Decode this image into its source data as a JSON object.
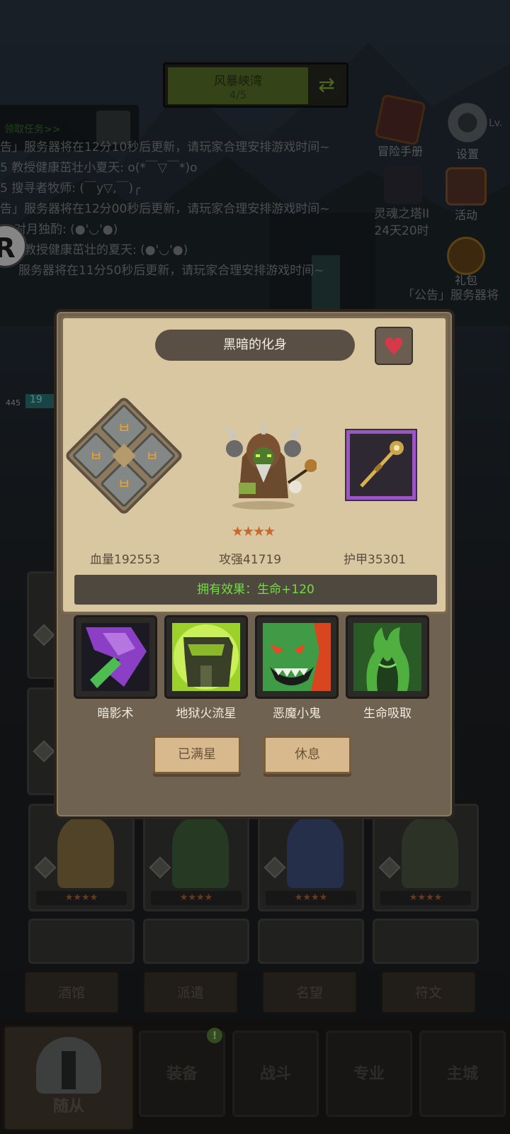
{
  "stage": {
    "name": "风暴峡湾",
    "progress": "4/5"
  },
  "quest": {
    "label": "领取任务>>"
  },
  "chat": [
    "告」服务器将在12分10秒后更新，请玩家合理安排游戏时间~",
    "5 教授健康茁壮小夏天: o(*￣▽￣*)o",
    "5 搜寻者牧师: (￣y▽,￣)╭",
    "告」服务器将在12分00秒后更新，请玩家合理安排游戏时间~",
    "对月独酌: (●'◡'●)",
    "教授健康茁壮的夏天: (●'◡'●)",
    "服务器将在11分50秒后更新，请玩家合理安排游戏时间~"
  ],
  "side_menu": {
    "handbook": "冒险手册",
    "settings": "设置",
    "level_prefix": "Lv.",
    "soul_tower": "灵魂之塔II",
    "soul_tower_timer": "24天20时",
    "activity": "活动",
    "gift": "礼包",
    "announce": "「公告」服务器将"
  },
  "badge_r": "R",
  "ally": {
    "level": "445",
    "hp": "19"
  },
  "hero": {
    "title": "黑暗的化身",
    "favorite_icon": "heart-icon",
    "stars": 4,
    "stars_text": "★★★★",
    "hp_label": "血量192553",
    "atk_label": "攻强41719",
    "armor_label": "护甲35301",
    "effect": "拥有效果：生命+120",
    "rune_glyph": "ㅂ"
  },
  "skills": [
    {
      "name": "暗影术",
      "icon": "shadow-crystal-icon",
      "color": "#8a3fc4"
    },
    {
      "name": "地狱火流星",
      "icon": "infernal-meteor-icon",
      "color": "#9bd12a"
    },
    {
      "name": "恶魔小鬼",
      "icon": "imp-face-icon",
      "color": "#3f9b45"
    },
    {
      "name": "生命吸取",
      "icon": "drain-life-icon",
      "color": "#3fa23d"
    }
  ],
  "buttons": {
    "max_star": "已满星",
    "rest": "休息"
  },
  "grid_stars": "★★★★",
  "sub_tabs": [
    "酒馆",
    "派遣",
    "名望",
    "符文"
  ],
  "nav": {
    "main": "随从",
    "equipment": "装备",
    "battle": "战斗",
    "profession": "专业",
    "city": "主城",
    "notify": "!"
  },
  "colors": {
    "parchment": "#d9c7a1",
    "effect_text": "#6ee03a",
    "epic_purple": "#9b55c4",
    "star": "#c7692c"
  }
}
